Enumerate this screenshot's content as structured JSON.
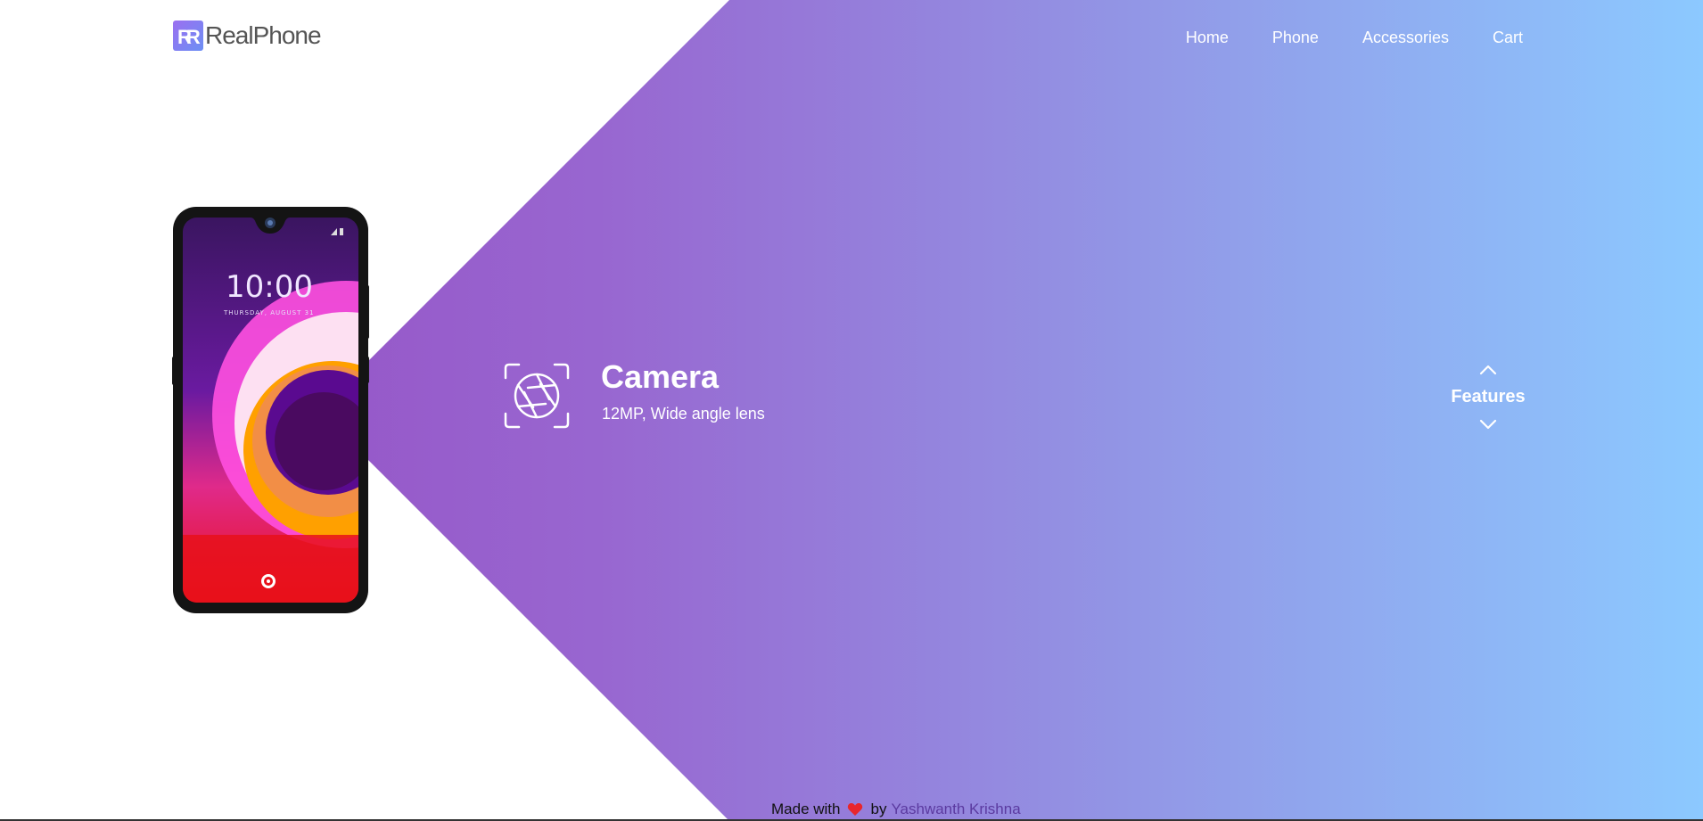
{
  "brand": {
    "logo_letters": "RR",
    "name": "RealPhone"
  },
  "nav": {
    "items": [
      "Home",
      "Phone",
      "Accessories",
      "Cart"
    ]
  },
  "phone_screen": {
    "time": "10:00",
    "date": "THURSDAY, AUGUST 31"
  },
  "feature": {
    "icon": "camera-aperture-icon",
    "title": "Camera",
    "description": "12MP, Wide angle lens"
  },
  "features_control": {
    "label": "Features",
    "up_icon": "chevron-up-icon",
    "down_icon": "chevron-down-icon"
  },
  "footer": {
    "prefix": "Made with",
    "icon": "heart-icon",
    "by": "by",
    "author": "Yashwanth Krishna"
  },
  "colors": {
    "gradient_start": "#9447c0",
    "gradient_end": "#8cc9ff",
    "heart": "#e8262c",
    "author_link": "#5b3aa0"
  }
}
